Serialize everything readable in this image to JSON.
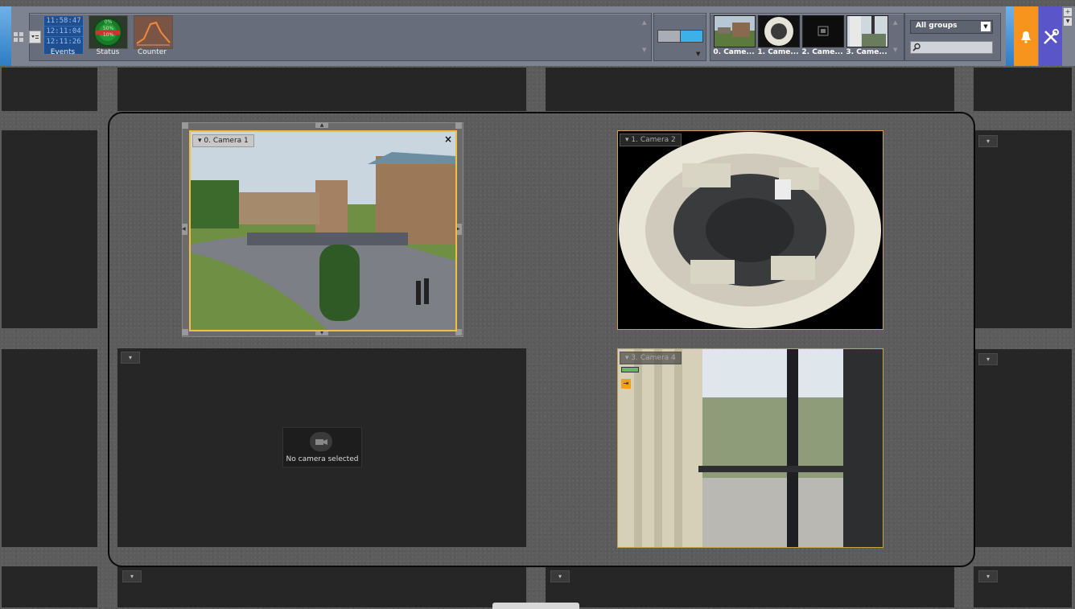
{
  "toolbar": {
    "times": [
      "11:58:47",
      "12:11:04",
      "12:11:26"
    ],
    "events_label": "Events",
    "status_label": "Status",
    "status_values": [
      "0%",
      "50%",
      "10%"
    ],
    "counter_label": "Counter",
    "thumbs": [
      "0. Came...",
      "1. Came...",
      "2. Came...",
      "3. Came..."
    ],
    "group_select": "All groups",
    "search_placeholder": ""
  },
  "cameras": [
    {
      "label": "0. Camera 1",
      "close": "×"
    },
    {
      "label": "1. Camera 2"
    },
    {
      "label": "3. Camera 4"
    }
  ],
  "empty_cell": {
    "text": "No camera selected"
  },
  "colors": {
    "accent_blue": "#2e7cc4",
    "alarm_orange": "#f7941d",
    "settings_purple": "#5a55c8",
    "selected_frame": "#f0c040"
  }
}
